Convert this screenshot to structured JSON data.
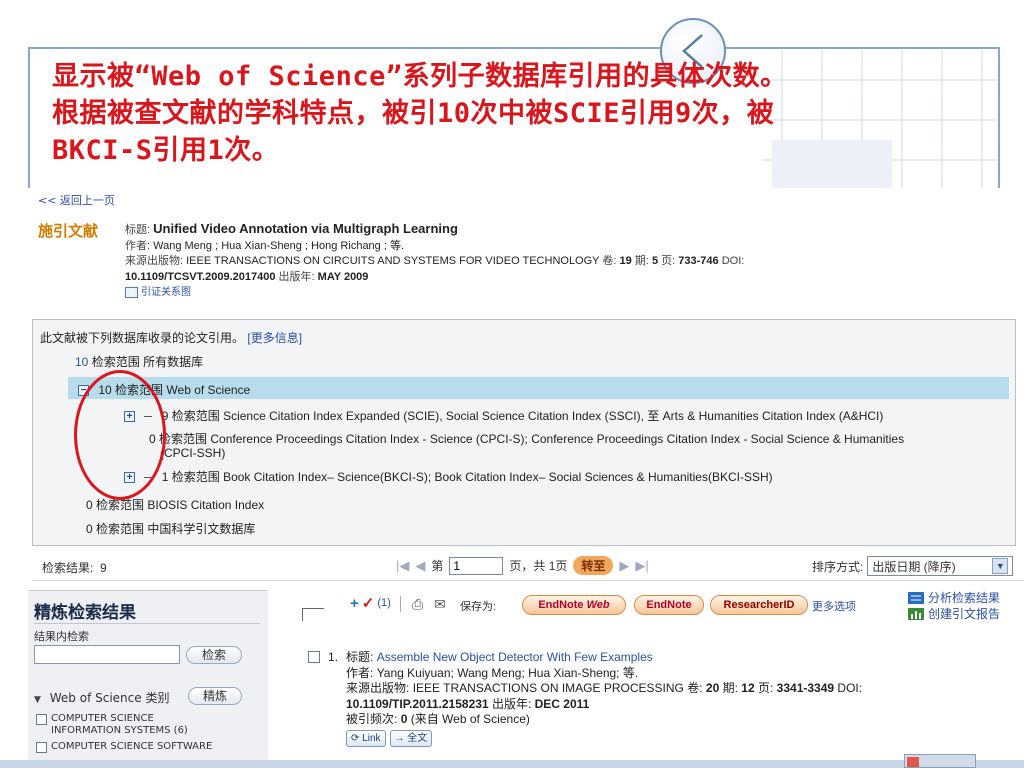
{
  "slide": {
    "line1": "显示被“Web of Science”系列子数据库引用的具体次数。",
    "line2": "根据被查文献的学科特点，被引10次中被SCIE引用9次，被",
    "line3": "BKCI-S引用1次。"
  },
  "record": {
    "back_link": "<< 返回上一页",
    "label": "施引文献",
    "title_key": "标题:",
    "title": "Unified Video Annotation via Multigraph Learning",
    "author_key": "作者:",
    "authors": "Wang Meng ; Hua Xian-Sheng ; Hong Richang ; 等.",
    "source_key": "来源出版物:",
    "source": "IEEE TRANSACTIONS ON CIRCUITS AND SYSTEMS FOR VIDEO TECHNOLOGY",
    "vol_key": "卷:",
    "vol": "19",
    "issue_key": "期:",
    "issue": "5",
    "page_key": "页:",
    "pages": "733-746",
    "doi_key": "DOI:",
    "doi": "10.1109/TCSVT.2009.2017400",
    "year_key": "出版年:",
    "year": "MAY 2009",
    "cite_map": "引证关系图"
  },
  "citing": {
    "intro": "此文献被下列数据库收录的论文引用。",
    "more_info": "[更多信息]",
    "scope_label": "检索范围",
    "all": {
      "count": "10",
      "name": "所有数据库"
    },
    "wos": {
      "count": "10",
      "name": "Web of Science"
    },
    "scie": {
      "count": "9",
      "name": "Science Citation Index Expanded (SCIE), Social Science Citation Index (SSCI), 至 Arts & Humanities Citation Index (A&HCI)"
    },
    "cpci": {
      "count": "0",
      "name": "Conference Proceedings Citation Index - Science (CPCI-S); Conference Proceedings Citation Index - Social Science & Humanities",
      "name_cont": "(CPCI-SSH)"
    },
    "bkci": {
      "count": "1",
      "name": "Book Citation Index– Science(BKCI-S); Book Citation Index– Social Sciences & Humanities(BKCI-SSH)"
    },
    "biosis": {
      "count": "0",
      "name": "BIOSIS Citation Index"
    },
    "cscd": {
      "count": "0",
      "name": "中国科学引文数据库"
    }
  },
  "results": {
    "label": "检索结果:",
    "count": "9",
    "page_prefix": "第",
    "page_value": "1",
    "page_suffix": "页，共 1页",
    "goto": "转至",
    "sort_label": "排序方式:",
    "sort_value": "出版日期 (降序)"
  },
  "refine": {
    "title": "精炼检索结果",
    "within": "结果内检索",
    "search_btn": "检索",
    "category": "Web of Science 类别",
    "refine_btn": "精炼",
    "options": [
      {
        "line1": "COMPUTER SCIENCE",
        "line2": "INFORMATION SYSTEMS (6)"
      },
      {
        "line1": "COMPUTER SCIENCE SOFTWARE",
        "line2": ""
      }
    ]
  },
  "toolbar": {
    "marked_count": "(1)",
    "save_to": "保存为:",
    "endnote_web_a": "EndNote",
    "endnote_web_b": "Web",
    "endnote": "EndNote",
    "researcher_id": "ResearcherID",
    "more_options": "更多选项",
    "analyze": "分析检索结果",
    "citation_report": "创建引文报告"
  },
  "item": {
    "num": "1.",
    "title_key": "标题:",
    "title": "Assemble New Object Detector With Few Examples",
    "author_key": "作者:",
    "authors": "Yang Kuiyuan; Wang Meng; Hua Xian-Sheng; 等.",
    "source_key": "来源出版物:",
    "source": "IEEE TRANSACTIONS ON IMAGE PROCESSING",
    "vol_key": "卷:",
    "vol": "20",
    "issue_key": "期:",
    "issue": "12",
    "page_key": "页:",
    "pages": "3341-3349",
    "doi_key": "DOI:",
    "doi": "10.1109/TIP.2011.2158231",
    "year_key": "出版年:",
    "year": "DEC 2011",
    "cited_key": "被引频次:",
    "cited": "0",
    "cited_suffix": "(来自 Web of Science)",
    "link_btn": "Link",
    "fulltext_btn": "→ 全文"
  },
  "colors": {
    "slide_text": "#d8161c",
    "link": "#2a50a8",
    "wos_highlight": "#b7dcec",
    "label_orange": "#d27d00"
  }
}
